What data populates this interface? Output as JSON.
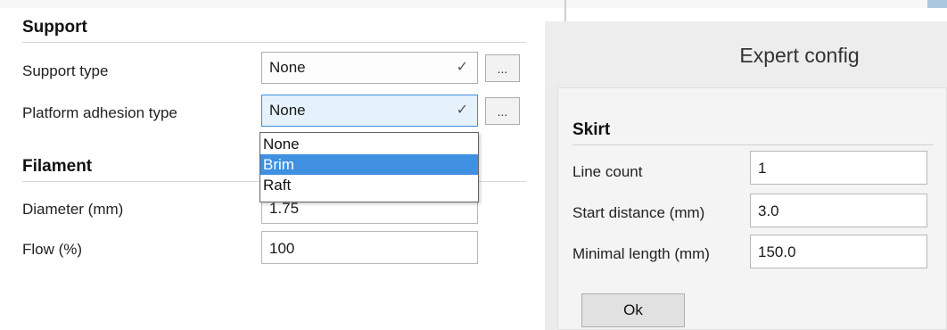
{
  "left": {
    "support": {
      "title": "Support",
      "support_type": {
        "label": "Support type",
        "value": "None",
        "more": "..."
      },
      "adhesion": {
        "label": "Platform adhesion type",
        "value": "None",
        "more": "...",
        "options": [
          "None",
          "Brim",
          "Raft"
        ],
        "highlighted": "Brim"
      }
    },
    "filament": {
      "title": "Filament",
      "diameter": {
        "label": "Diameter (mm)",
        "value": "1.75"
      },
      "flow": {
        "label": "Flow (%)",
        "value": "100"
      }
    }
  },
  "dialog": {
    "title": "Expert config",
    "skirt": {
      "title": "Skirt",
      "line_count": {
        "label": "Line count",
        "value": "1"
      },
      "start_distance": {
        "label": "Start distance (mm)",
        "value": "3.0"
      },
      "minimal_length": {
        "label": "Minimal length (mm)",
        "value": "150.0"
      }
    },
    "ok_label": "Ok"
  },
  "colors": {
    "highlight": "#3f90e0",
    "focus_border": "#3d8ed9",
    "accent_bar": "#a9c8e0"
  }
}
